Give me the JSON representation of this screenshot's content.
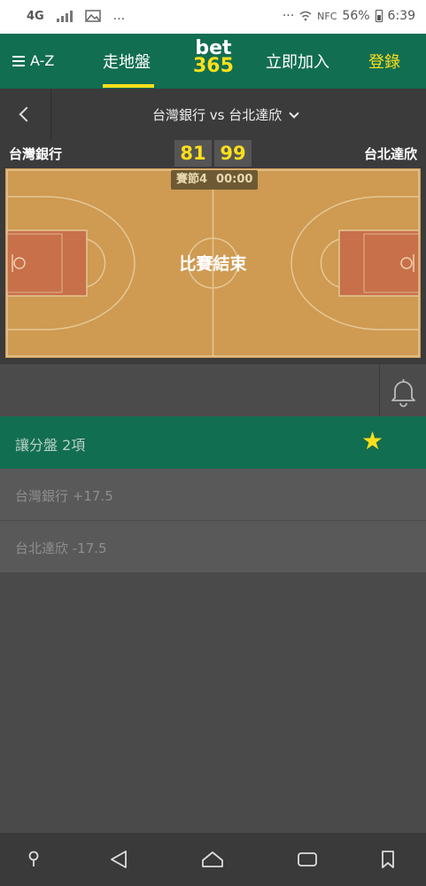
{
  "status_bar": {
    "network": "4G",
    "more": "...",
    "nfc": "NFC",
    "battery": "56%",
    "time": "6:39"
  },
  "nav": {
    "menu_label": "A-Z",
    "inplay_label": "走地盤",
    "logo_top": "bet",
    "logo_bottom": "365",
    "join_label": "立即加入",
    "login_label": "登錄",
    "accent_color": "#126e51",
    "highlight_color": "#ffdf1b"
  },
  "match": {
    "title": "台灣銀行 vs 台北達欣",
    "home_team": "台灣銀行",
    "away_team": "台北達欣",
    "home_score": "81",
    "away_score": "99",
    "period": "賽節4",
    "clock": "00:00",
    "status": "比賽結束"
  },
  "market": {
    "title": "讓分盤 2項",
    "starred": true,
    "selections": [
      {
        "label": "台灣銀行 +17.5"
      },
      {
        "label": "台北達欣 -17.5"
      }
    ]
  },
  "icons": {
    "menu": "hamburger-icon",
    "back": "chevron-left-icon",
    "dropdown": "chevron-down-icon",
    "bell": "bell-icon",
    "star": "star-icon"
  }
}
